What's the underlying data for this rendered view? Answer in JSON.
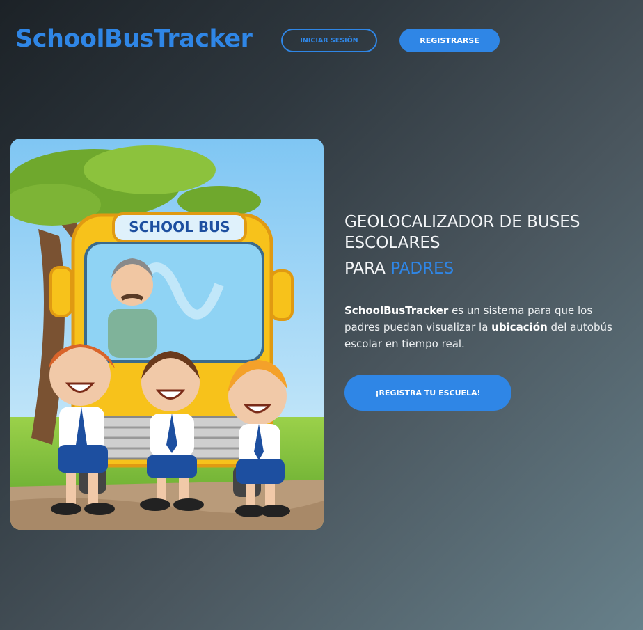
{
  "header": {
    "logo": "SchoolBusTracker",
    "login_label": "INICIAR SESIÓN",
    "register_label": "REGISTRARSE"
  },
  "hero": {
    "image_sign": "SCHOOL BUS",
    "headline_line1": "GEOLOCALIZADOR DE BUSES",
    "headline_line2": "ESCOLARES",
    "headline_prefix": "PARA ",
    "headline_accent": "PADRES",
    "desc_brand": "SchoolBusTracker",
    "desc_part1": " es un sistema para que los padres puedan visualizar la ",
    "desc_strong": "ubicación",
    "desc_part2": " del autobús escolar en tiempo real.",
    "cta_label": "¡REGISTRA TU ESCUELA!"
  },
  "colors": {
    "accent": "#2f86e6",
    "bus_yellow": "#f7c21b",
    "text": "#ffffff"
  }
}
